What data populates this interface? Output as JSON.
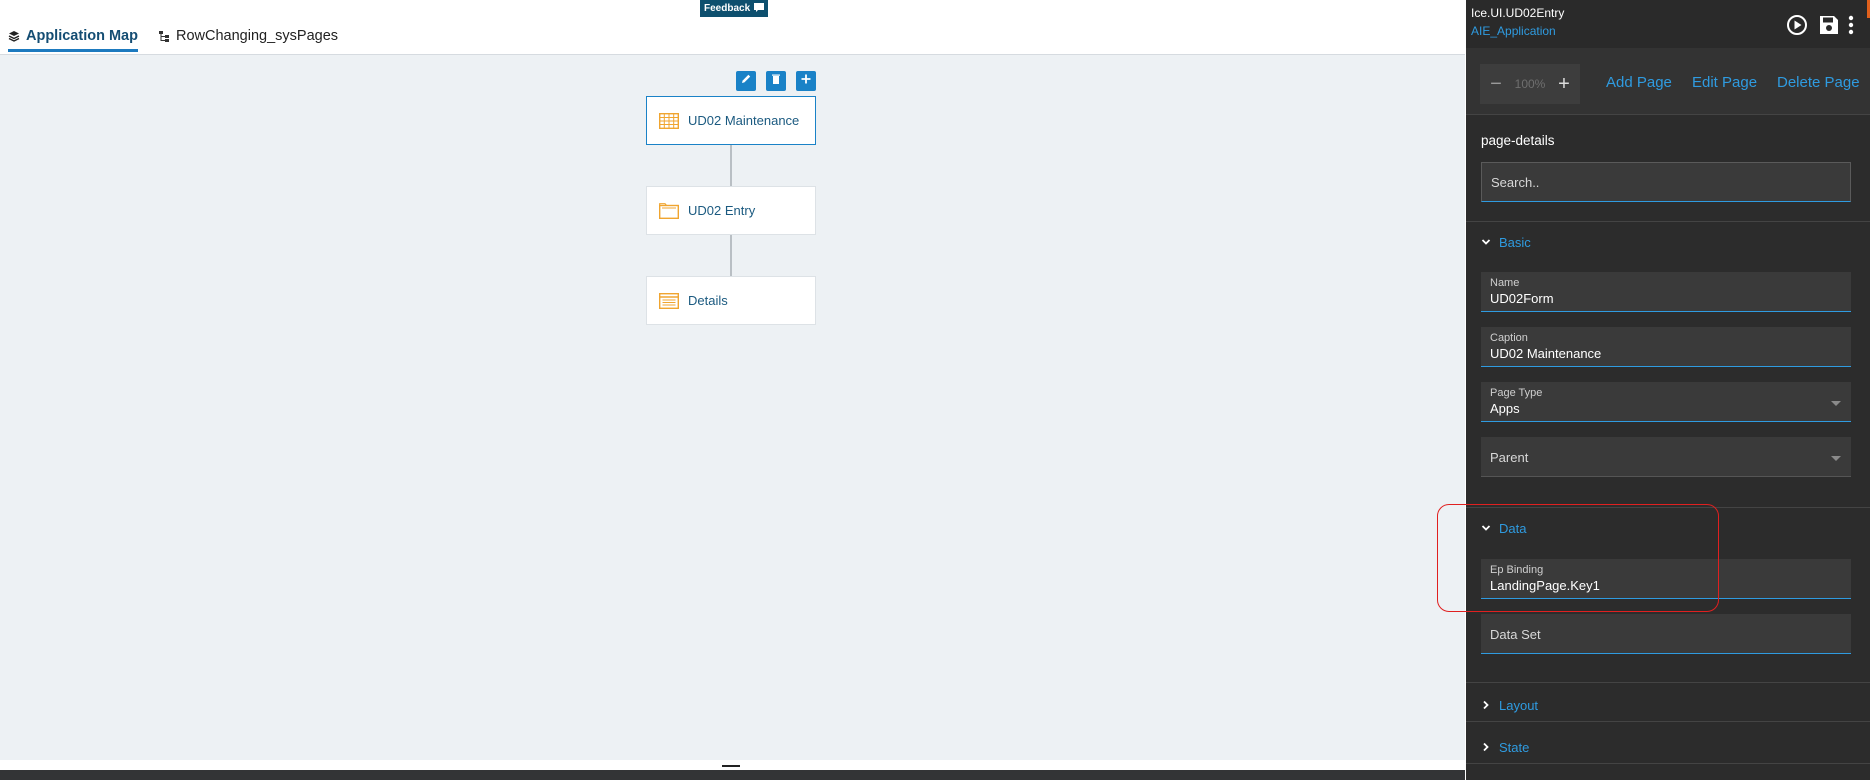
{
  "feedback": {
    "label": "Feedback"
  },
  "tabs": [
    {
      "label": "Application Map",
      "icon": "layers-icon",
      "active": true
    },
    {
      "label": "RowChanging_sysPages",
      "icon": "tree-icon",
      "active": false
    }
  ],
  "map": {
    "toolbar": [
      "edit-icon",
      "delete-icon",
      "add-icon"
    ],
    "nodes": [
      {
        "label": "UD02 Maintenance",
        "icon": "grid-icon",
        "selected": true
      },
      {
        "label": "UD02 Entry",
        "icon": "folder-icon",
        "selected": false
      },
      {
        "label": "Details",
        "icon": "list-icon",
        "selected": false
      }
    ]
  },
  "panel": {
    "app_path": "Ice.UI.UD02Entry",
    "app_name": "AIE_Application",
    "zoom": {
      "value": "100%",
      "minus": "−",
      "plus": "+"
    },
    "actions": {
      "add": "Add Page",
      "edit": "Edit Page",
      "delete": "Delete Page"
    },
    "section_title": "page-details",
    "search_placeholder": "Search..",
    "groups": {
      "basic": "Basic",
      "data": "Data",
      "layout": "Layout",
      "state": "State"
    },
    "fields": {
      "name": {
        "label": "Name",
        "value": "UD02Form"
      },
      "caption": {
        "label": "Caption",
        "value": "UD02 Maintenance"
      },
      "page_type": {
        "label": "Page Type",
        "value": "Apps"
      },
      "parent": {
        "label": "Parent"
      },
      "ep_binding": {
        "label": "Ep Binding",
        "value": "LandingPage.Key1"
      },
      "data_set": {
        "label": "Data Set"
      }
    }
  },
  "colors": {
    "accent": "#1a82c7",
    "link": "#2f9be0",
    "node_icon": "#f0a530",
    "highlight": "#e02020"
  }
}
